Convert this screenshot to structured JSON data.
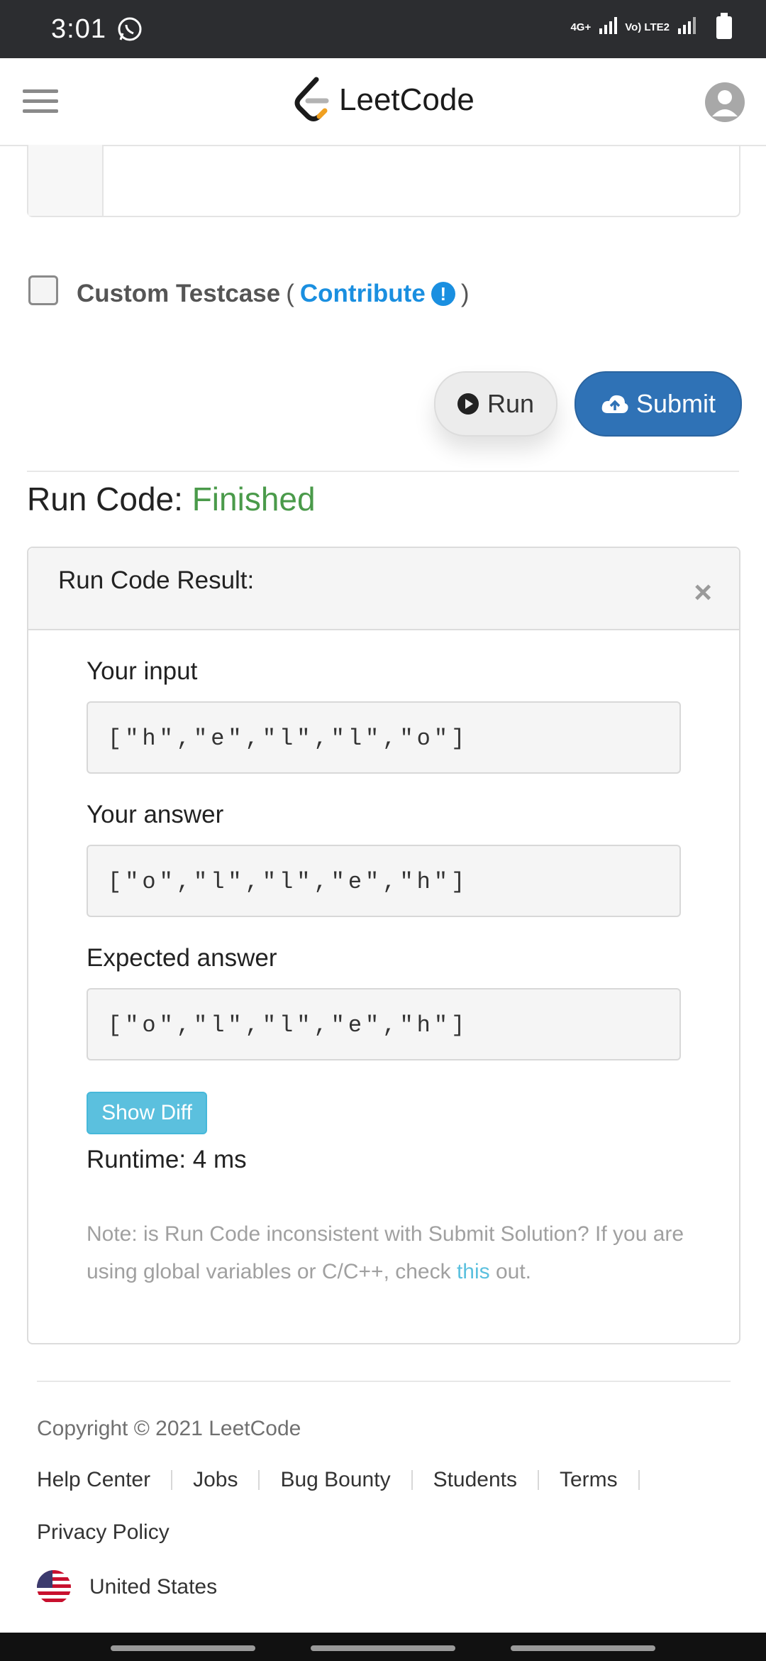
{
  "status_bar": {
    "time": "3:01",
    "net1": "4G+",
    "net2": "Vo) LTE2"
  },
  "header": {
    "logo_text": "LeetCode"
  },
  "custom_testcase": {
    "label": "Custom Testcase",
    "open_paren": "(",
    "contribute": "Contribute",
    "info_glyph": "!",
    "close_paren": ")"
  },
  "buttons": {
    "run": "Run",
    "submit": "Submit"
  },
  "run_code": {
    "label": "Run Code:",
    "status": "Finished"
  },
  "result": {
    "title": "Run Code Result:",
    "close_glyph": "×",
    "input_label": "Your input",
    "input_value": "[\"h\",\"e\",\"l\",\"l\",\"o\"]",
    "answer_label": "Your answer",
    "answer_value": "[\"o\",\"l\",\"l\",\"e\",\"h\"]",
    "expected_label": "Expected answer",
    "expected_value": "[\"o\",\"l\",\"l\",\"e\",\"h\"]",
    "show_diff": "Show Diff",
    "runtime": "Runtime: 4 ms",
    "note_before": "Note: is Run Code inconsistent with Submit Solution? If you are using global variables or C/C++, check ",
    "note_link": "this",
    "note_after": " out."
  },
  "footer": {
    "copyright": "Copyright © 2021 LeetCode",
    "links": [
      "Help Center",
      "Jobs",
      "Bug Bounty",
      "Students",
      "Terms"
    ],
    "privacy": "Privacy Policy",
    "country": "United States"
  },
  "colors": {
    "accent_blue": "#1a8fe0",
    "submit_blue": "#2f72b6",
    "finished_green": "#4a9a4a",
    "diff_button": "#5bc0de"
  }
}
